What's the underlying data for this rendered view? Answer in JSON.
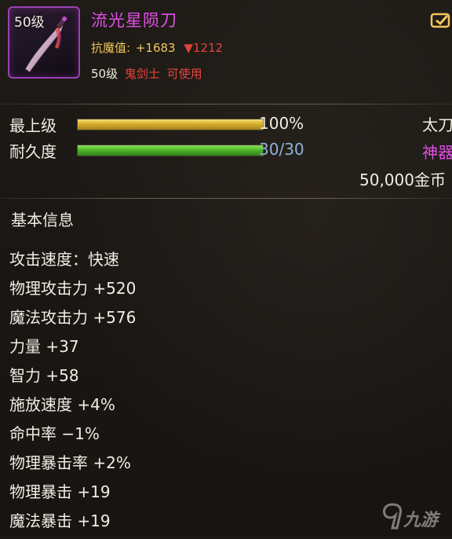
{
  "item": {
    "level_badge": "50级",
    "name": "流光星陨刀",
    "resist_label": "抗魔值:",
    "resist_value": "+1683",
    "resist_drop": "▼1212",
    "req_level": "50级",
    "req_class": "鬼剑士",
    "req_usable": "可使用"
  },
  "bars": [
    {
      "label": "最上级",
      "value_text": "100%",
      "fraction": 1.0,
      "color": "#d9ae2c"
    },
    {
      "label": "耐久度",
      "value_text": "30/30",
      "fraction": 1.0,
      "color": "#4fb82b"
    }
  ],
  "right_info": {
    "type": "太刀",
    "grade": "神器",
    "price": "50,000金币"
  },
  "section": {
    "title": "基本信息"
  },
  "stats": [
    "攻击速度：快速",
    "物理攻击力 +520",
    "魔法攻击力 +576",
    "力量 +37",
    "智力 +58",
    "施放速度 +4%",
    "命中率 −1%",
    "物理暴击率 +2%",
    "物理暴击 +19",
    "魔法暴击 +19"
  ],
  "watermark": {
    "text": "九游"
  },
  "icons": {
    "weapon": "blade-icon",
    "compare": "compare-icon",
    "watermark_logo": "nine-game-logo-icon"
  }
}
